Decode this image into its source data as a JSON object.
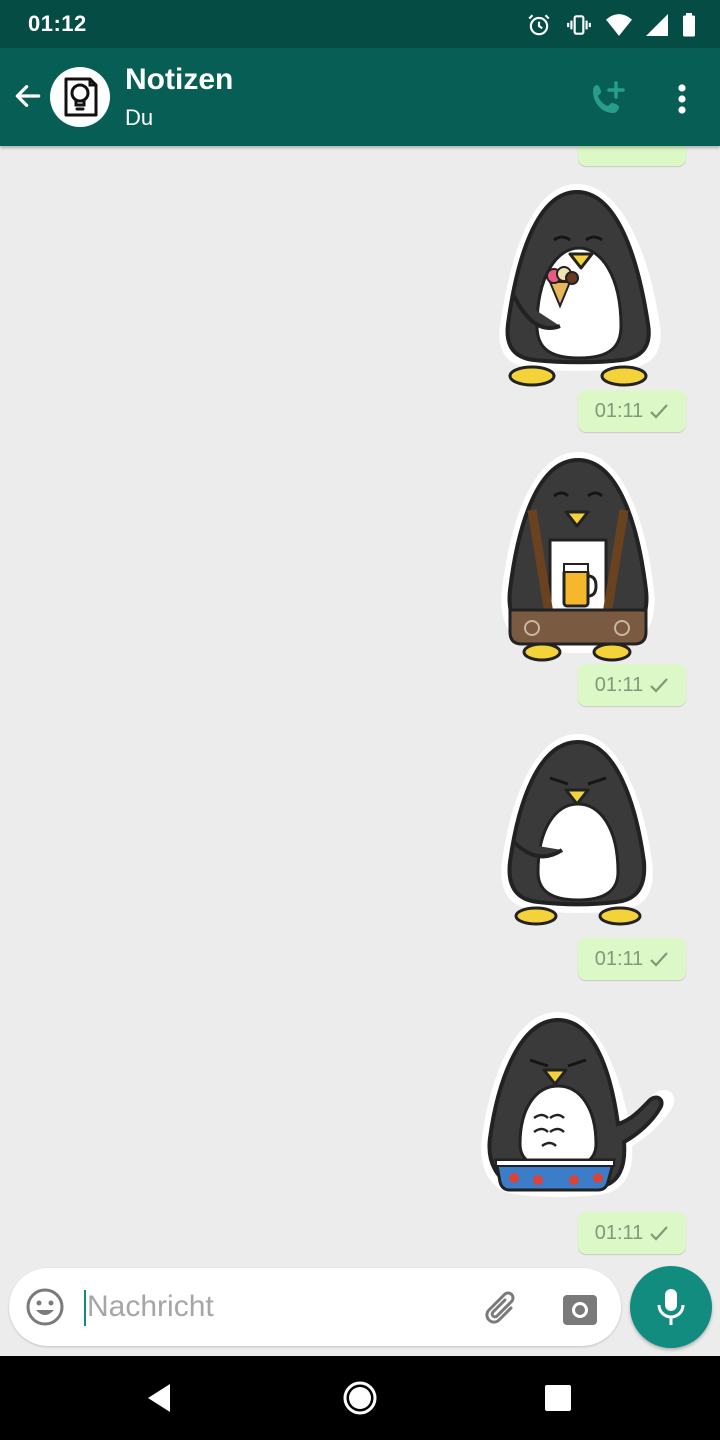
{
  "status_bar": {
    "time": "01:12",
    "icons": [
      "alarm-icon",
      "vibrate-icon",
      "wifi-icon",
      "cell-signal-icon",
      "battery-icon"
    ]
  },
  "header": {
    "title": "Notizen",
    "subtitle": "Du",
    "avatar_icon": "lightbulb-note-icon",
    "actions": [
      "add-call-icon",
      "more-vert-icon"
    ]
  },
  "messages": [
    {
      "type": "sticker",
      "sticker": "penguin-eating-ice-cream",
      "time": "01:11",
      "status": "sent-check-icon"
    },
    {
      "type": "sticker",
      "sticker": "penguin-lederhosen-beer",
      "time": "01:11",
      "status": "sent-check-icon"
    },
    {
      "type": "sticker",
      "sticker": "penguin-grumpy",
      "time": "01:11",
      "status": "sent-check-icon"
    },
    {
      "type": "sticker",
      "sticker": "penguin-dropping-pants",
      "time": "01:11",
      "status": "sent-check-icon"
    }
  ],
  "composer": {
    "placeholder": "Nachricht",
    "value": "",
    "icons": [
      "emoji-icon",
      "paperclip-icon",
      "camera-icon",
      "mic-icon"
    ]
  },
  "nav_bar": {
    "icons": [
      "back-triangle-icon",
      "home-circle-icon",
      "recents-square-icon"
    ]
  },
  "colors": {
    "status_bar": "#054d44",
    "app_bar": "#075e54",
    "accent": "#128c7e",
    "outgoing_bubble": "#dcf8c6",
    "chat_background": "#ececec"
  }
}
